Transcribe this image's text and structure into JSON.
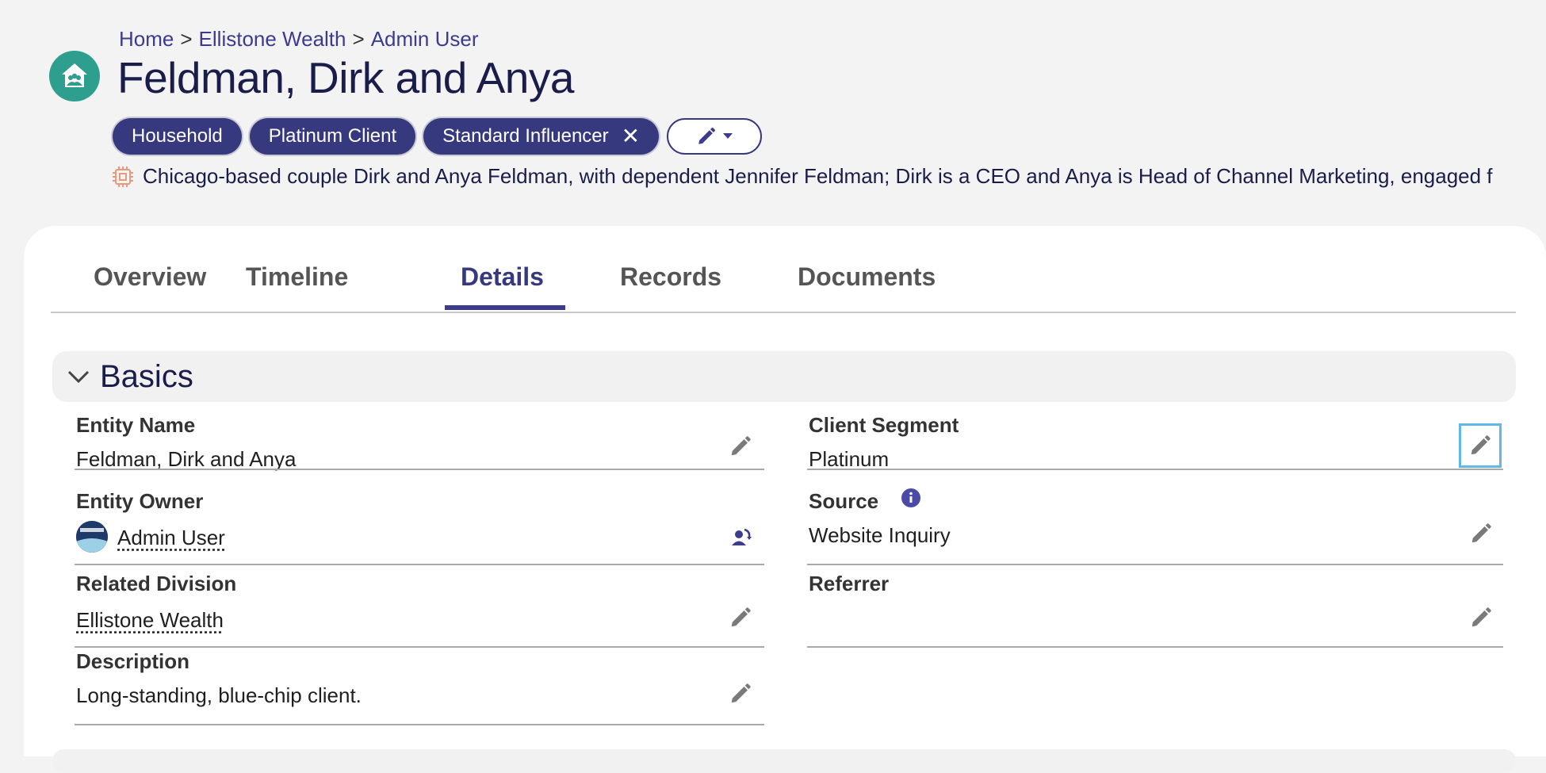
{
  "breadcrumb": {
    "items": [
      "Home",
      "Ellistone Wealth",
      "Admin User"
    ],
    "separator": ">"
  },
  "header": {
    "icon": "household-icon",
    "title": "Feldman, Dirk and Anya",
    "tags": [
      "Household",
      "Platinum Client",
      "Standard Influencer"
    ],
    "removable_tag_index": 2,
    "summary": "Chicago-based couple Dirk and Anya Feldman, with dependent Jennifer Feldman; Dirk is a CEO and Anya is Head of Channel Marketing, engaged f"
  },
  "tabs": [
    "Overview",
    "Timeline",
    "Details",
    "Records",
    "Documents"
  ],
  "active_tab": "Details",
  "section": {
    "title": "Basics",
    "fields": {
      "entity_name": {
        "label": "Entity Name",
        "value": "Feldman, Dirk and Anya"
      },
      "entity_owner": {
        "label": "Entity Owner",
        "value": "Admin User"
      },
      "related_division": {
        "label": "Related Division",
        "value": "Ellistone Wealth"
      },
      "description": {
        "label": "Description",
        "value": "Long-standing, blue-chip client."
      },
      "client_segment": {
        "label": "Client Segment",
        "value": "Platinum"
      },
      "source": {
        "label": "Source",
        "value": "Website Inquiry"
      },
      "referrer": {
        "label": "Referrer",
        "value": ""
      }
    }
  },
  "colors": {
    "brand": "#36397e",
    "link": "#3d3b8e",
    "household_icon_bg": "#2e9e8f",
    "focus": "#5fb8e8"
  }
}
